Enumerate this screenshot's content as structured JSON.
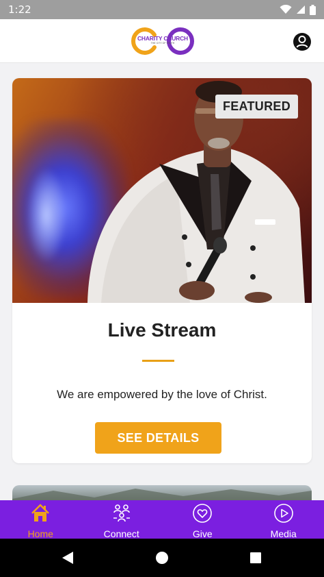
{
  "status_bar": {
    "time": "1:22"
  },
  "header": {
    "logo_text": "CHARITY CHURCH",
    "logo_subtext": "THE CITY OF TRUTH",
    "profile_icon": "account-circle-icon"
  },
  "featured_card": {
    "badge": "FEATURED",
    "title": "Live Stream",
    "description": "We are empowered by the love of Christ.",
    "button_label": "SEE DETAILS"
  },
  "bottom_nav": {
    "items": [
      {
        "label": "Home",
        "icon": "home-icon",
        "active": true
      },
      {
        "label": "Connect",
        "icon": "people-icon",
        "active": false
      },
      {
        "label": "Give",
        "icon": "heart-icon",
        "active": false
      },
      {
        "label": "Media",
        "icon": "play-icon",
        "active": false
      }
    ]
  },
  "colors": {
    "accent": "#f0a31a",
    "nav_background": "#7b1fe0",
    "logo_orange": "#f0a31a",
    "logo_purple": "#7a2fbf"
  }
}
